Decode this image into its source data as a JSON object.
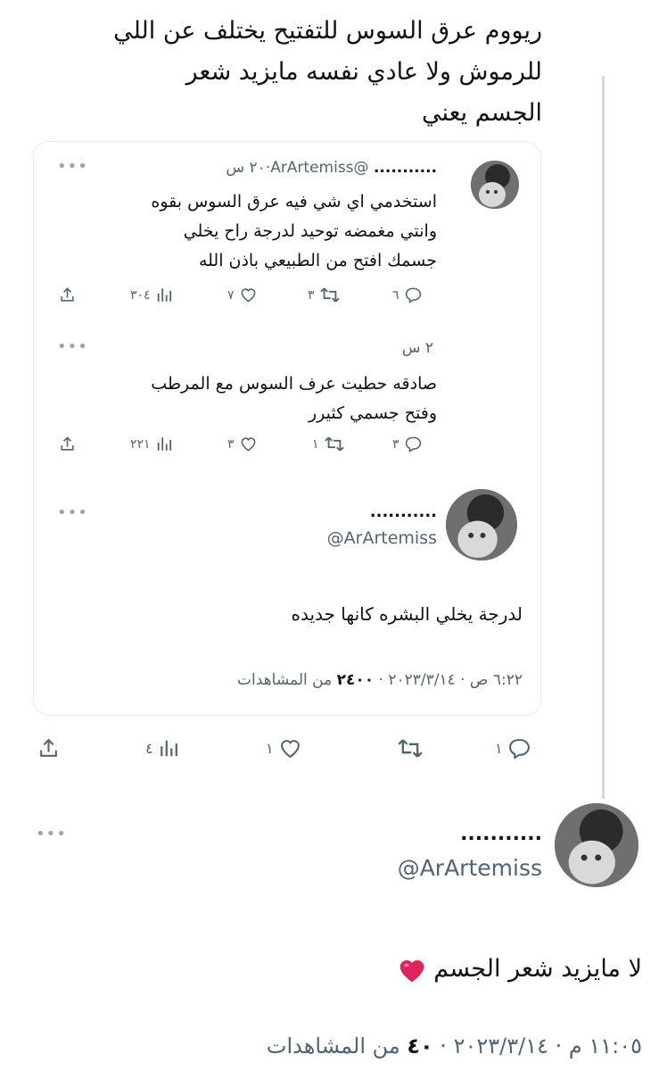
{
  "main_tweet": {
    "lines": [
      "ريووم عرق السوس للتفتيح يختلف عن اللي",
      "للرموش ولا عادي نفسه مايزيد شعر",
      "الجسم يعني"
    ]
  },
  "quote": {
    "tweet1": {
      "name": "...........",
      "handle": "@ArArtemiss",
      "dot": "·",
      "time": "٢٠ س",
      "more": "•••",
      "lines": [
        "استخدمي اي شي فيه عرق السوس بقوه",
        "وانتي مغمضه توحيد لدرجة راح يخلي",
        "جسمك افتح من الطبيعي باذن الله"
      ],
      "actions": {
        "replies": "٦",
        "retweets": "٣",
        "likes": "٧",
        "views": "٣٠٤"
      }
    },
    "tweet2": {
      "time": "٢ س",
      "more": "•••",
      "lines": [
        "صادقه حطيت عرف السوس مع المرطب",
        "وفتح جسمي كثيرر"
      ],
      "actions": {
        "replies": "٣",
        "retweets": "١",
        "likes": "٣",
        "views": "٢٢١"
      }
    },
    "tweet3": {
      "name": "...........",
      "handle": "@ArArtemiss",
      "more": "•••",
      "text": "لدرجة يخلي البشره كانها جديده",
      "meta_prefix": "٦:٢٢ ص · ٢٠٢٣/٣/١٤ · ",
      "views_count": "٢٤٠٠",
      "views_label": " من المشاهدات"
    }
  },
  "main_actions": {
    "replies": "١",
    "retweets": "",
    "likes": "١",
    "views": "٤"
  },
  "reply": {
    "name": "...........",
    "handle": "@ArArtemiss",
    "more": "•••",
    "text": "لا مايزيد شعر الجسم",
    "meta_prefix": "١١:٠٥ م · ٢٠٢٣/٣/١٤ · ",
    "views_count": "٤٠",
    "views_label": " من المشاهدات"
  },
  "colors": {
    "text": "#0f1419",
    "secondary": "#536471",
    "border": "#e6ecf0",
    "heart": "#e0245e"
  }
}
